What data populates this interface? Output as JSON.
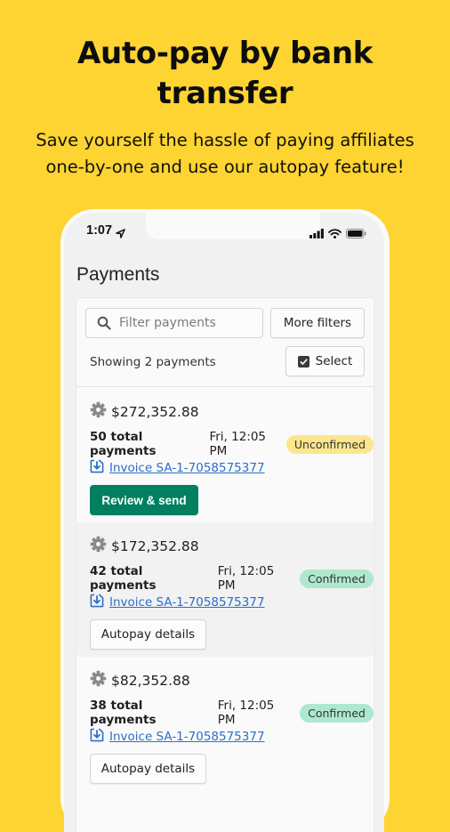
{
  "promo": {
    "headline_line1": "Auto-pay by bank",
    "headline_line2": "transfer",
    "subline_line1": "Save yourself the hassle of paying affiliates",
    "subline_line2": "one-by-one and use our autopay feature!",
    "background_color": "#fdd431"
  },
  "status_bar": {
    "time": "1:07",
    "icons": [
      "location-arrow-icon",
      "signal-icon",
      "wifi-icon",
      "battery-icon"
    ]
  },
  "page": {
    "title": "Payments"
  },
  "filters": {
    "search_placeholder": "Filter payments",
    "search_value": "",
    "more_filters_label": "More filters",
    "select_label": "Select",
    "showing_text": "Showing 2 payments"
  },
  "payments": [
    {
      "amount": "$272,352.88",
      "total_payments": "50 total payments",
      "datetime": "Fri, 12:05 PM",
      "status": "Unconfirmed",
      "invoice": "Invoice SA-1-7058575377",
      "action_label": "Review & send",
      "action_type": "primary"
    },
    {
      "amount": "$172,352.88",
      "total_payments": "42 total payments",
      "datetime": "Fri, 12:05 PM",
      "status": "Confirmed",
      "invoice": "Invoice SA-1-7058575377",
      "action_label": "Autopay details",
      "action_type": "secondary"
    },
    {
      "amount": "$82,352.88",
      "total_payments": "38 total payments",
      "datetime": "Fri, 12:05 PM",
      "status": "Confirmed",
      "invoice": "Invoice SA-1-7058575377",
      "action_label": "Autopay details",
      "action_type": "secondary"
    }
  ],
  "colors": {
    "primary_button": "#008060",
    "unconfirmed_badge": "#fbe68c",
    "confirmed_badge": "#aee8cf",
    "link": "#2c6ecb"
  }
}
